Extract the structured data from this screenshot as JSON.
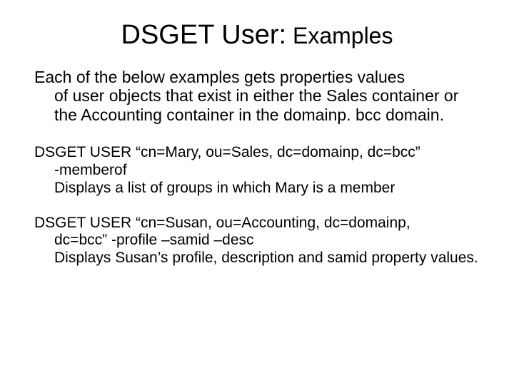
{
  "title": {
    "main": "DSGET User:",
    "sub": " Examples"
  },
  "intro": {
    "line1": "Each of the below examples gets properties values",
    "rest": "of user objects that exist in either the Sales container or the Accounting container in the domainp. bcc domain."
  },
  "example1": {
    "cmd": "DSGET USER “cn=Mary, ou=Sales, dc=domainp, dc=bcc”",
    "opt": "-memberof",
    "desc": "Displays a list of groups in which Mary is a member"
  },
  "example2": {
    "cmd": "DSGET USER “cn=Susan, ou=Accounting, dc=domainp,",
    "cmd2": "dc=bcc”  -profile –samid –desc",
    "desc": "Displays Susan’s profile, description and samid property values."
  }
}
